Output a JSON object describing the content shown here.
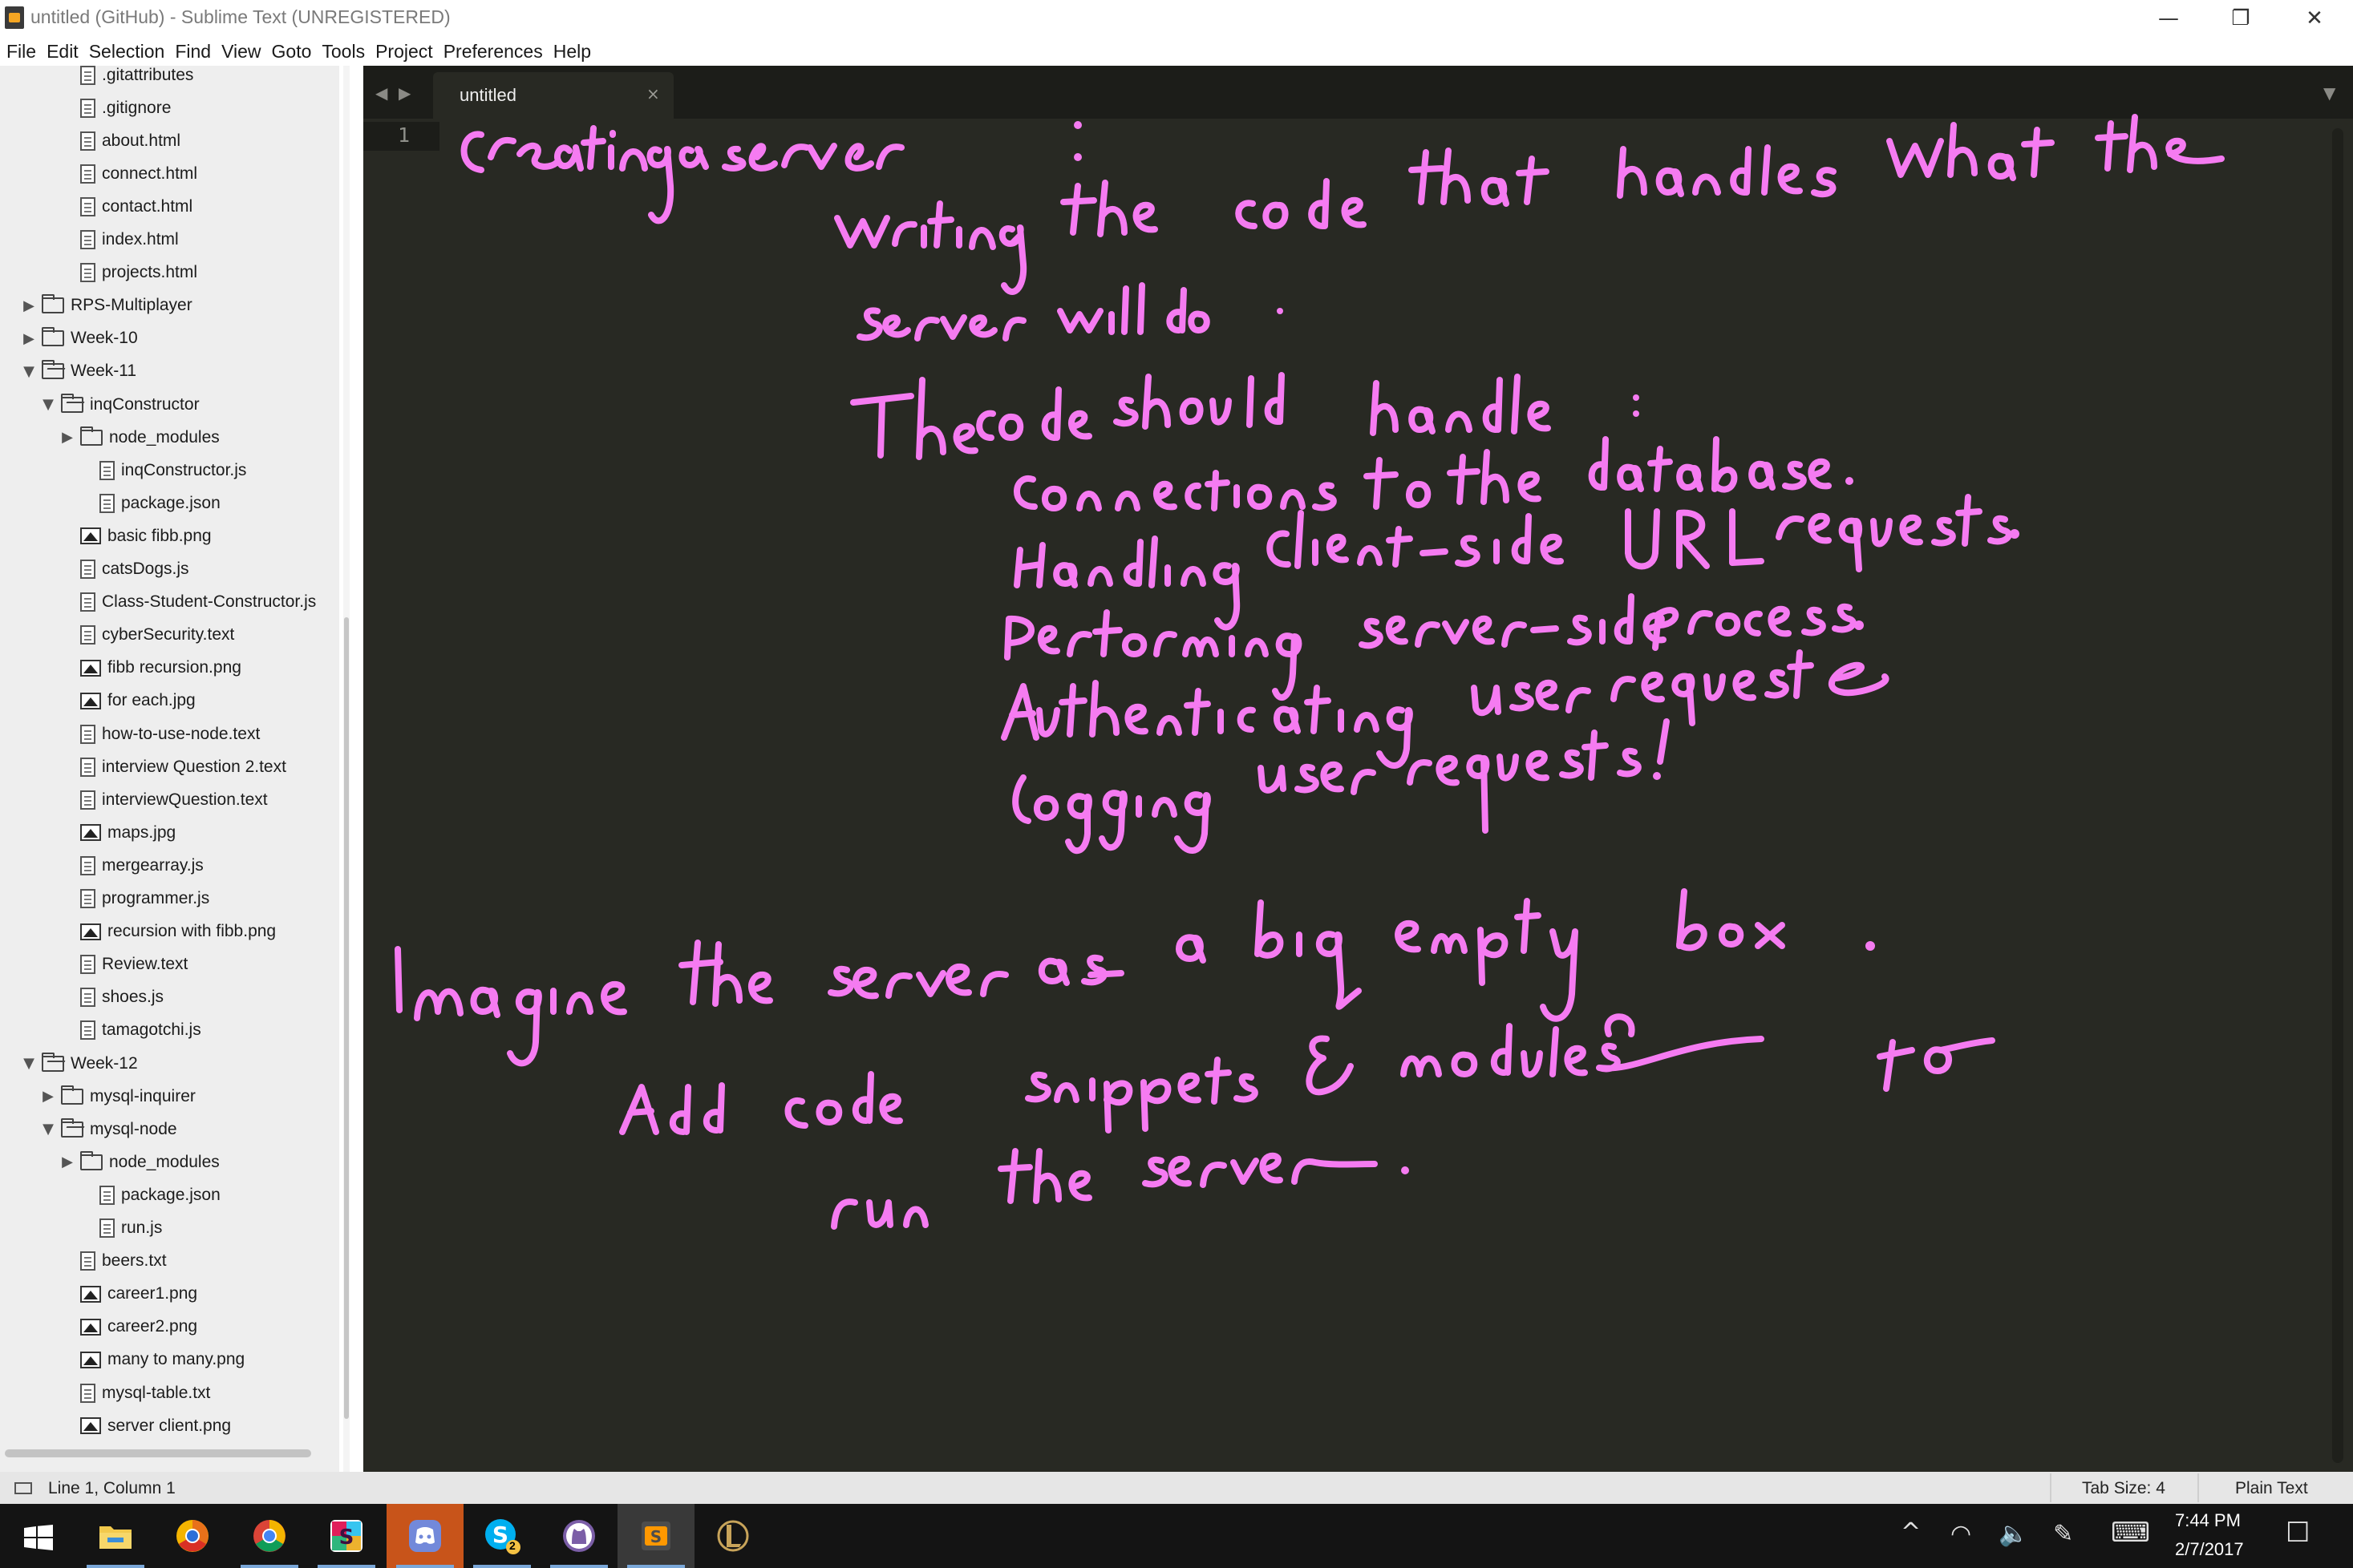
{
  "window": {
    "title": "untitled (GitHub) - Sublime Text (UNREGISTERED)",
    "minimize_glyph": "—",
    "maximize_glyph": "❐",
    "close_glyph": "✕"
  },
  "menu": [
    "File",
    "Edit",
    "Selection",
    "Find",
    "View",
    "Goto",
    "Tools",
    "Project",
    "Preferences",
    "Help"
  ],
  "sidebar": {
    "items": [
      {
        "label": ".gitattributes",
        "type": "file",
        "depth": 4,
        "arrow": ""
      },
      {
        "label": ".gitignore",
        "type": "file",
        "depth": 4,
        "arrow": ""
      },
      {
        "label": "about.html",
        "type": "file",
        "depth": 4,
        "arrow": ""
      },
      {
        "label": "connect.html",
        "type": "file",
        "depth": 4,
        "arrow": ""
      },
      {
        "label": "contact.html",
        "type": "file",
        "depth": 4,
        "arrow": ""
      },
      {
        "label": "index.html",
        "type": "file",
        "depth": 4,
        "arrow": ""
      },
      {
        "label": "projects.html",
        "type": "file",
        "depth": 4,
        "arrow": ""
      },
      {
        "label": "RPS-Multiplayer",
        "type": "folder",
        "depth": 2,
        "arrow": "▶"
      },
      {
        "label": "Week-10",
        "type": "folder",
        "depth": 2,
        "arrow": "▶"
      },
      {
        "label": "Week-11",
        "type": "folder-open",
        "depth": 2,
        "arrow": "▼"
      },
      {
        "label": "inqConstructor",
        "type": "folder-open",
        "depth": 3,
        "arrow": "▼"
      },
      {
        "label": "node_modules",
        "type": "folder",
        "depth": 4,
        "arrow": "▶"
      },
      {
        "label": "inqConstructor.js",
        "type": "file",
        "depth": 5,
        "arrow": ""
      },
      {
        "label": "package.json",
        "type": "file",
        "depth": 5,
        "arrow": ""
      },
      {
        "label": "basic fibb.png",
        "type": "image",
        "depth": 4,
        "arrow": ""
      },
      {
        "label": "catsDogs.js",
        "type": "file",
        "depth": 4,
        "arrow": ""
      },
      {
        "label": "Class-Student-Constructor.js",
        "type": "file",
        "depth": 4,
        "arrow": ""
      },
      {
        "label": "cyberSecurity.text",
        "type": "file",
        "depth": 4,
        "arrow": ""
      },
      {
        "label": "fibb recursion.png",
        "type": "image",
        "depth": 4,
        "arrow": ""
      },
      {
        "label": "for each.jpg",
        "type": "image",
        "depth": 4,
        "arrow": ""
      },
      {
        "label": "how-to-use-node.text",
        "type": "file",
        "depth": 4,
        "arrow": ""
      },
      {
        "label": "interview Question 2.text",
        "type": "file",
        "depth": 4,
        "arrow": ""
      },
      {
        "label": "interviewQuestion.text",
        "type": "file",
        "depth": 4,
        "arrow": ""
      },
      {
        "label": "maps.jpg",
        "type": "image",
        "depth": 4,
        "arrow": ""
      },
      {
        "label": "mergearray.js",
        "type": "file",
        "depth": 4,
        "arrow": ""
      },
      {
        "label": "programmer.js",
        "type": "file",
        "depth": 4,
        "arrow": ""
      },
      {
        "label": "recursion with fibb.png",
        "type": "image",
        "depth": 4,
        "arrow": ""
      },
      {
        "label": "Review.text",
        "type": "file",
        "depth": 4,
        "arrow": ""
      },
      {
        "label": "shoes.js",
        "type": "file",
        "depth": 4,
        "arrow": ""
      },
      {
        "label": "tamagotchi.js",
        "type": "file",
        "depth": 4,
        "arrow": ""
      },
      {
        "label": "Week-12",
        "type": "folder-open",
        "depth": 2,
        "arrow": "▼"
      },
      {
        "label": "mysql-inquirer",
        "type": "folder",
        "depth": 3,
        "arrow": "▶"
      },
      {
        "label": "mysql-node",
        "type": "folder-open",
        "depth": 3,
        "arrow": "▼"
      },
      {
        "label": "node_modules",
        "type": "folder",
        "depth": 4,
        "arrow": "▶"
      },
      {
        "label": "package.json",
        "type": "file",
        "depth": 5,
        "arrow": ""
      },
      {
        "label": "run.js",
        "type": "file",
        "depth": 5,
        "arrow": ""
      },
      {
        "label": "beers.txt",
        "type": "file",
        "depth": 4,
        "arrow": ""
      },
      {
        "label": "career1.png",
        "type": "image",
        "depth": 4,
        "arrow": ""
      },
      {
        "label": "career2.png",
        "type": "image",
        "depth": 4,
        "arrow": ""
      },
      {
        "label": "many to many.png",
        "type": "image",
        "depth": 4,
        "arrow": ""
      },
      {
        "label": "mysql-table.txt",
        "type": "file",
        "depth": 4,
        "arrow": ""
      },
      {
        "label": "server client.png",
        "type": "image",
        "depth": 4,
        "arrow": ""
      }
    ]
  },
  "editor": {
    "tab_label": "untitled",
    "tab_close_glyph": "×",
    "nav_left_glyph": "◀",
    "nav_right_glyph": "▶",
    "tab_dropdown_glyph": "▼",
    "line_number": "1",
    "ink_color": "#f57bf1",
    "handwritten_lines": [
      "creating a server:",
      "writing the code that handles what the",
      "server will do.",
      "The code should handle:",
      "Connections to the database.",
      "Handling client-side URL requests.",
      "Performing server-side process.",
      "Authenticating user requests",
      "logging user requests!",
      "Imagine the server as a big empty box.",
      "Add code snippets & modules to",
      "run the server."
    ]
  },
  "statusbar": {
    "position": "Line 1, Column 1",
    "tab_size": "Tab Size: 4",
    "syntax": "Plain Text"
  },
  "taskbar": {
    "apps": [
      "file-explorer",
      "chrome-canary",
      "chrome",
      "slack",
      "discord",
      "skype",
      "github-desktop",
      "sublime-text",
      "league-of-legends"
    ],
    "skype_badge": "2",
    "tray": {
      "chevron_glyph": "^",
      "wifi_glyph": "◠",
      "volume_glyph": "🔈",
      "pen_glyph": "✎",
      "keyboard_glyph": "⌨",
      "notification_glyph": "☐"
    },
    "time": "7:44 PM",
    "date": "2/7/2017"
  }
}
